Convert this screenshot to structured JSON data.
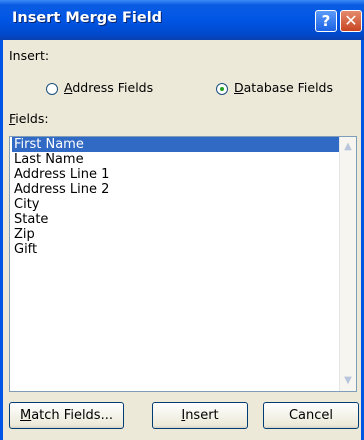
{
  "window": {
    "title": "Insert Merge Field"
  },
  "titlebar": {
    "help_glyph": "?",
    "close_glyph": "✕"
  },
  "insert": {
    "label": "Insert:",
    "options": [
      {
        "label": "Address Fields",
        "mnemonic": "A",
        "rest": "ddress Fields",
        "selected": false
      },
      {
        "label": "Database Fields",
        "mnemonic": "D",
        "rest": "atabase Fields",
        "selected": true
      }
    ]
  },
  "fields": {
    "label": "Fields:",
    "mnemonic": "F",
    "rest": "ields:",
    "items": [
      "First Name",
      "Last Name",
      "Address Line 1",
      "Address Line 2",
      "City",
      "State",
      "Zip",
      "Gift"
    ],
    "selected_index": 0
  },
  "buttons": {
    "match_fields": {
      "mnemonic": "M",
      "rest": "atch Fields..."
    },
    "insert": {
      "mnemonic": "I",
      "rest": "nsert"
    },
    "cancel": "Cancel"
  },
  "colors": {
    "titlebar": "#0055e5",
    "selection": "#316ac5",
    "face": "#ece9d8"
  }
}
